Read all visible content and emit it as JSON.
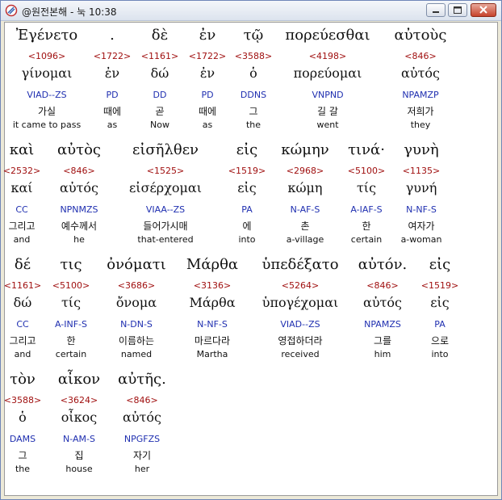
{
  "window": {
    "title": "@원전본해 - 눅 10:38"
  },
  "rows": [
    [
      {
        "greek": "Ἐγένετο",
        "num": "<1096>",
        "lemma": "γίνομαι",
        "parse": "VIAD--ZS",
        "kor": "가실",
        "eng": "it came to pass"
      },
      {
        "greek": ".",
        "num": "<1722>",
        "lemma": "ἐν",
        "parse": "PD",
        "kor": "때에",
        "eng": "as"
      },
      {
        "greek": "δὲ",
        "num": "<1161>",
        "lemma": "δώ",
        "parse": "DD",
        "kor": "곧",
        "eng": "Now"
      },
      {
        "greek": "ἐν",
        "num": "<1722>",
        "lemma": "ἐν",
        "parse": "PD",
        "kor": "때에",
        "eng": "as"
      },
      {
        "greek": "τῷ",
        "num": "<3588>",
        "lemma": "ὁ",
        "parse": "DDNS",
        "kor": "그",
        "eng": "the"
      },
      {
        "greek": "πορεύεσθαι",
        "num": "<4198>",
        "lemma": "πορεύομαι",
        "parse": "VNPND",
        "kor": "길 갈",
        "eng": "went"
      },
      {
        "greek": "αὐτοὺς",
        "num": "<846>",
        "lemma": "αὐτός",
        "parse": "NPAMZP",
        "kor": "저희가",
        "eng": "they"
      }
    ],
    [
      {
        "greek": "καὶ",
        "num": "<2532>",
        "lemma": "καί",
        "parse": "CC",
        "kor": "그리고",
        "eng": "and"
      },
      {
        "greek": "αὐτὸς",
        "num": "<846>",
        "lemma": "αὐτός",
        "parse": "NPNMZS",
        "kor": "예수께서",
        "eng": "he"
      },
      {
        "greek": "εἰσῆλθεν",
        "num": "<1525>",
        "lemma": "εἰσέρχομαι",
        "parse": "VIAA--ZS",
        "kor": "들어가시매",
        "eng": "that-entered"
      },
      {
        "greek": "εἰς",
        "num": "<1519>",
        "lemma": "εἰς",
        "parse": "PA",
        "kor": "에",
        "eng": "into"
      },
      {
        "greek": "κώμην",
        "num": "<2968>",
        "lemma": "κώμη",
        "parse": "N-AF-S",
        "kor": "촌",
        "eng": "a-village"
      },
      {
        "greek": "τινά·",
        "num": "<5100>",
        "lemma": "τίς",
        "parse": "A-IAF-S",
        "kor": "한",
        "eng": "certain"
      },
      {
        "greek": "γυνὴ",
        "num": "<1135>",
        "lemma": "γυνή",
        "parse": "N-NF-S",
        "kor": "여자가",
        "eng": "a-woman"
      }
    ],
    [
      {
        "greek": "δέ",
        "num": "<1161>",
        "lemma": "δώ",
        "parse": "CC",
        "kor": "그리고",
        "eng": "and"
      },
      {
        "greek": "τις",
        "num": "<5100>",
        "lemma": "τίς",
        "parse": "A-INF-S",
        "kor": "한",
        "eng": "certain"
      },
      {
        "greek": "ὀνόματι",
        "num": "<3686>",
        "lemma": "ὄνομα",
        "parse": "N-DN-S",
        "kor": "이름하는",
        "eng": "named"
      },
      {
        "greek": "Μάρθα",
        "num": "<3136>",
        "lemma": "Μάρθα",
        "parse": "N-NF-S",
        "kor": "마르다라",
        "eng": "Martha"
      },
      {
        "greek": "ὑπεδέξατο",
        "num": "<5264>",
        "lemma": "ὑπογέχομαι",
        "parse": "VIAD--ZS",
        "kor": "영접하더라",
        "eng": "received"
      },
      {
        "greek": "αὐτόν.",
        "num": "<846>",
        "lemma": "αὐτός",
        "parse": "NPAMZS",
        "kor": "그를",
        "eng": "him"
      },
      {
        "greek": "εἰς",
        "num": "<1519>",
        "lemma": "εἰς",
        "parse": "PA",
        "kor": "으로",
        "eng": "into"
      }
    ],
    [
      {
        "greek": "τὸν",
        "num": "<3588>",
        "lemma": "ὁ",
        "parse": "DAMS",
        "kor": "그",
        "eng": "the"
      },
      {
        "greek": "αἶκον",
        "num": "<3624>",
        "lemma": "οἶκος",
        "parse": "N-AM-S",
        "kor": "집",
        "eng": "house"
      },
      {
        "greek": "αὐτῆς.",
        "num": "<846>",
        "lemma": "αὐτός",
        "parse": "NPGFZS",
        "kor": "자기",
        "eng": "her"
      }
    ]
  ]
}
